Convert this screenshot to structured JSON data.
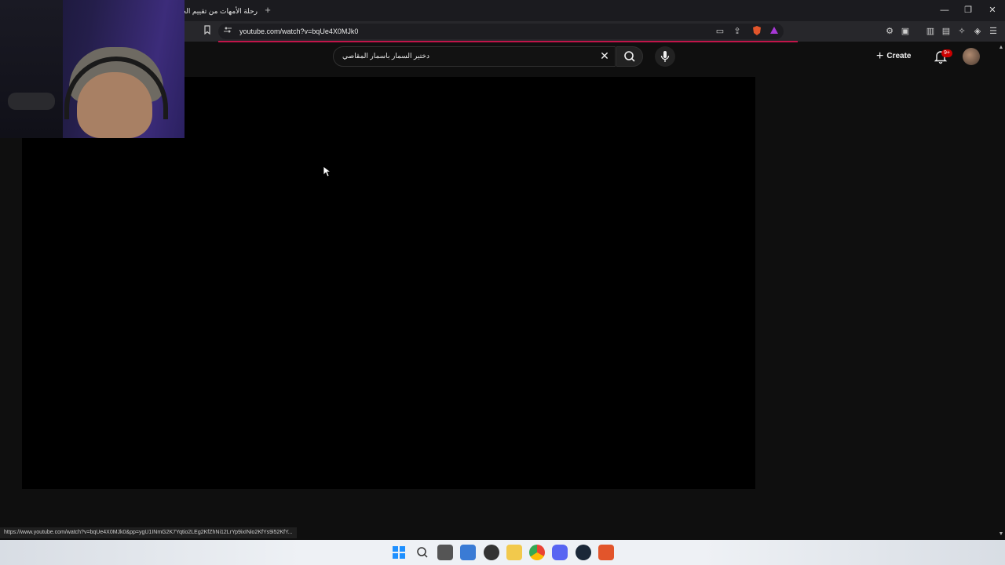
{
  "browser": {
    "tab_title": "رحلة الأمهات من تقييم الجـ",
    "new_tab_label": "+",
    "address": "youtube.com/watch?v=bqUe4X0MJk0",
    "window_controls": {
      "minimize": "—",
      "maximize": "❐",
      "close": "✕"
    }
  },
  "youtube": {
    "search_value": "دختير السمار باسمار المقاصي",
    "create_label": "Create",
    "notifications_badge": "9+"
  },
  "status_bar": {
    "link_url": "https://www.youtube.com/watch?v=bqUe4X0MJk0&pp=ygU1INmG2K7Yqtio2LEg2KfZhNi12LrYp9ixINio2KfYs9i52KfY..."
  },
  "colors": {
    "page_bg": "#0f0f0f",
    "video_bg": "#000000",
    "load_bar": "#c1154a",
    "badge": "#cc0000"
  },
  "icons": {
    "bookmark": "bookmark-icon",
    "site_info": "site-info-icon",
    "clear": "clear-icon",
    "search": "search-icon",
    "mic": "mic-icon",
    "bell": "bell-icon"
  }
}
